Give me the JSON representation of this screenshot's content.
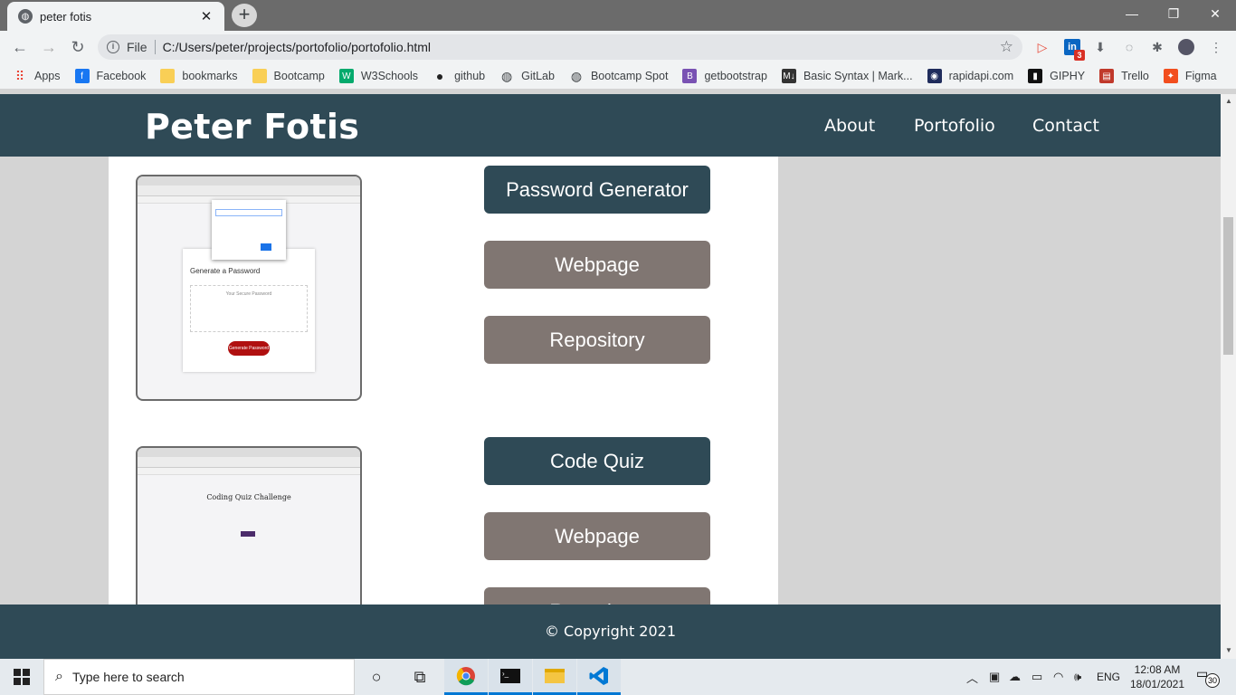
{
  "browser": {
    "tab_title": "peter fotis",
    "tab_close": "✕",
    "new_tab": "+",
    "window_controls": {
      "minimize": "—",
      "restore": "❐",
      "close": "✕"
    },
    "address": {
      "scheme": "File",
      "url": "C:/Users/peter/projects/portofolio/portofolio.html"
    },
    "extension_badge": "3",
    "bookmarks": [
      {
        "label": "Apps",
        "icon": "apps-grid-icon",
        "color": "#ea4335"
      },
      {
        "label": "Facebook",
        "icon": "facebook-icon",
        "color": "#1877f2"
      },
      {
        "label": "bookmarks",
        "icon": "folder-icon",
        "color": "#f9cf56"
      },
      {
        "label": "Bootcamp",
        "icon": "folder-icon",
        "color": "#f9cf56"
      },
      {
        "label": "W3Schools",
        "icon": "w3schools-icon",
        "color": "#04aa6d"
      },
      {
        "label": "github",
        "icon": "github-icon",
        "color": "#222222"
      },
      {
        "label": "GitLab",
        "icon": "globe-icon",
        "color": "#3c4043"
      },
      {
        "label": "Bootcamp Spot",
        "icon": "globe-icon",
        "color": "#3c4043"
      },
      {
        "label": "getbootstrap",
        "icon": "bootstrap-icon",
        "color": "#7952b3"
      },
      {
        "label": "Basic Syntax | Mark...",
        "icon": "markdown-icon",
        "color": "#333333"
      },
      {
        "label": "rapidapi.com",
        "icon": "rapidapi-icon",
        "color": "#1f2c5c"
      },
      {
        "label": "GIPHY",
        "icon": "giphy-icon",
        "color": "#111111"
      },
      {
        "label": "Trello",
        "icon": "trello-icon",
        "color": "#c0392b"
      },
      {
        "label": "Figma",
        "icon": "figma-icon",
        "color": "#f24e1e"
      }
    ]
  },
  "site": {
    "brand": "Peter Fotis",
    "nav": [
      "About",
      "Portofolio",
      "Contact"
    ],
    "projects": [
      {
        "thumbnail": "password-generator-screenshot",
        "thumb_heading": "Generate a Password",
        "thumb_text": "Your Secure Password",
        "thumb_button": "Generate Password",
        "title_button": "Password Generator",
        "webpage_button": "Webpage",
        "repo_button": "Repository"
      },
      {
        "thumbnail": "code-quiz-screenshot",
        "thumb_heading": "Coding Quiz Challenge",
        "title_button": "Code Quiz",
        "webpage_button": "Webpage",
        "repo_button": "Repository"
      }
    ],
    "footer": "© Copyright 2021",
    "colors": {
      "header": "#2f4a56",
      "primary_button": "#2f4a56",
      "secondary_button": "#807672",
      "page_bg": "#d4d4d4"
    }
  },
  "taskbar": {
    "search_placeholder": "Type here to search",
    "language": "ENG",
    "time": "12:08 AM",
    "date": "18/01/2021",
    "notifications": "30"
  }
}
